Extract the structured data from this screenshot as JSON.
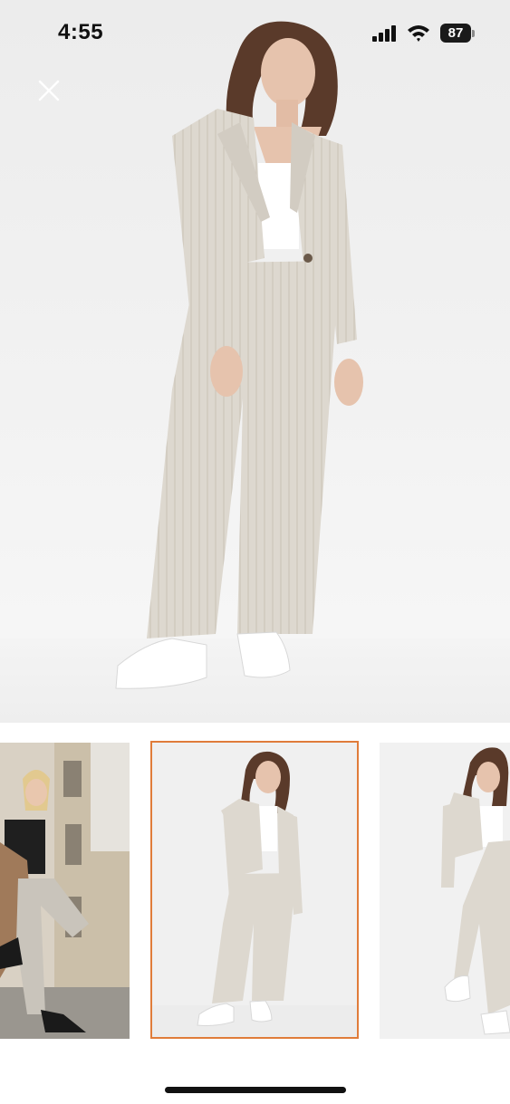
{
  "status_bar": {
    "time": "4:55",
    "battery_level": "87",
    "icons": [
      "cellular-signal-icon",
      "wifi-icon",
      "battery-icon"
    ]
  },
  "viewer": {
    "close_icon": "close-icon",
    "thumbnails": [
      {
        "name": "thumbnail-street-photo",
        "selected": false
      },
      {
        "name": "thumbnail-studio-front",
        "selected": true
      },
      {
        "name": "thumbnail-studio-side",
        "selected": false
      }
    ]
  },
  "colors": {
    "selection_border": "#e07c3a",
    "suit": "#ddd8d0",
    "background": "#f2f2f2"
  }
}
